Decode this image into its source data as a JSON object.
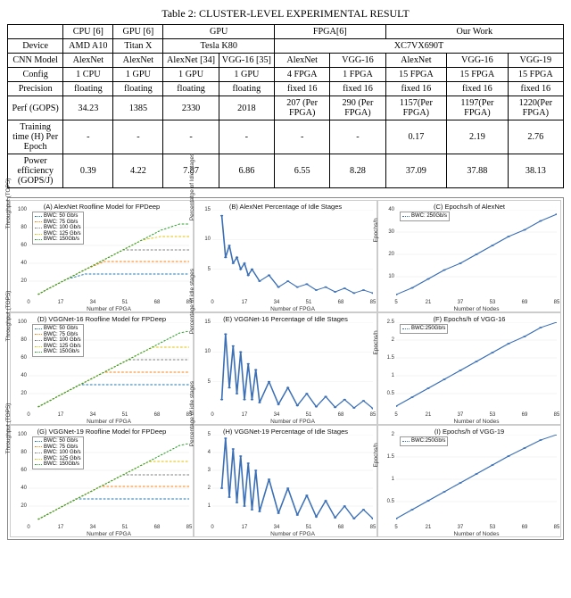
{
  "table": {
    "caption": "Table 2: CLUSTER-LEVEL EXPERIMENTAL RESULT",
    "col_headers_1": [
      "",
      "CPU [6]",
      "GPU [6]",
      "GPU",
      "GPU",
      "FPGA[6]",
      "FPGA[6]",
      "Our Work",
      "Our Work",
      "Our Work"
    ],
    "gpu_span_label": "GPU",
    "fpga_span_label": "FPGA[6]",
    "ourwork_span_label": "Our Work",
    "rows": [
      {
        "label": "Device",
        "cells": [
          "AMD A10",
          "Titan X",
          "Tesla K80",
          "Tesla K80",
          "XC7VX690T",
          "XC7VX690T",
          "XC7VX690T",
          "XC7VX690T",
          "XC7VX690T"
        ],
        "spans": {
          "tesla": "Tesla K80",
          "xc": "XC7VX690T"
        }
      },
      {
        "label": "CNN Model",
        "cells": [
          "AlexNet",
          "AlexNet",
          "AlexNet [34]",
          "VGG-16 [35]",
          "AlexNet",
          "VGG-16",
          "AlexNet",
          "VGG-16",
          "VGG-19"
        ]
      },
      {
        "label": "Config",
        "cells": [
          "1 CPU",
          "1 GPU",
          "1 GPU",
          "1 GPU",
          "4 FPGA",
          "1 FPGA",
          "15 FPGA",
          "15 FPGA",
          "15 FPGA"
        ]
      },
      {
        "label": "Precision",
        "cells": [
          "floating",
          "floating",
          "floating",
          "floating",
          "fixed 16",
          "fixed 16",
          "fixed 16",
          "fixed 16",
          "fixed 16"
        ]
      },
      {
        "label": "Perf (GOPS)",
        "cells": [
          "34.23",
          "1385",
          "2330",
          "2018",
          "207 (Per FPGA)",
          "290 (Per FPGA)",
          "1157(Per FPGA)",
          "1197(Per FPGA)",
          "1220(Per FPGA)"
        ]
      },
      {
        "label": "Training time (H) Per Epoch",
        "cells": [
          "-",
          "-",
          "-",
          "-",
          "-",
          "-",
          "0.17",
          "2.19",
          "2.76"
        ]
      },
      {
        "label": "Power efficiency (GOPS/J)",
        "cells": [
          "0.39",
          "4.22",
          "7.87",
          "6.86",
          "6.55",
          "8.28",
          "37.09",
          "37.88",
          "38.13"
        ]
      }
    ]
  },
  "chart_data": [
    {
      "id": "A",
      "type": "line",
      "title": "(A) AlexNet Roofline Model for FPDeep",
      "xlabel": "Number of FPGA",
      "ylabel": "Throughput (TOPS)",
      "xlim": [
        0,
        85
      ],
      "ylim": [
        0,
        100
      ],
      "yticks": [
        20,
        40,
        60,
        80,
        100
      ],
      "legend_pos": "tl",
      "series": [
        {
          "name": "BWC: 50 Gb/s",
          "color": "#1f77b4",
          "x": [
            5,
            10,
            20,
            30,
            40,
            50,
            60,
            70,
            80,
            85
          ],
          "y": [
            5,
            11,
            22,
            28,
            28,
            28,
            28,
            28,
            28,
            28
          ]
        },
        {
          "name": "BWC: 75 Gb/s",
          "color": "#ff7f0e",
          "x": [
            5,
            10,
            20,
            30,
            40,
            50,
            60,
            70,
            80,
            85
          ],
          "y": [
            5,
            11,
            22,
            33,
            42,
            42,
            42,
            42,
            42,
            42
          ]
        },
        {
          "name": "BWC: 100 Gb/s",
          "color": "#7f7f7f",
          "x": [
            5,
            10,
            20,
            30,
            40,
            50,
            60,
            70,
            80,
            85
          ],
          "y": [
            5,
            11,
            22,
            33,
            44,
            55,
            55,
            55,
            55,
            55
          ]
        },
        {
          "name": "BWC: 125 Gb/s",
          "color": "#e6c200",
          "x": [
            5,
            10,
            20,
            30,
            40,
            50,
            60,
            70,
            80,
            85
          ],
          "y": [
            5,
            11,
            22,
            33,
            44,
            55,
            66,
            70,
            70,
            70
          ]
        },
        {
          "name": "BWC: 150Gb/s",
          "color": "#2ca02c",
          "x": [
            5,
            10,
            20,
            30,
            40,
            50,
            60,
            70,
            80,
            85
          ],
          "y": [
            5,
            11,
            22,
            33,
            44,
            55,
            66,
            77,
            84,
            84
          ]
        }
      ]
    },
    {
      "id": "B",
      "type": "line",
      "title": "(B) AlexNet Percentage of Idle Stages",
      "xlabel": "Number of FPGA",
      "ylabel": "Percentatge of Idle stages",
      "xlim": [
        0,
        85
      ],
      "ylim": [
        0,
        15
      ],
      "yticks": [
        5,
        10,
        15
      ],
      "legend_pos": "none",
      "series": [
        {
          "name": "",
          "color": "#3b6fb6",
          "x": [
            5,
            7,
            9,
            11,
            13,
            15,
            17,
            19,
            21,
            25,
            30,
            35,
            40,
            45,
            50,
            55,
            60,
            65,
            70,
            75,
            80,
            85
          ],
          "y": [
            14,
            7,
            9,
            6,
            7,
            5,
            6,
            4,
            5,
            3,
            4,
            2,
            3,
            2,
            2.5,
            1.5,
            2,
            1.2,
            1.8,
            1,
            1.5,
            1
          ]
        }
      ]
    },
    {
      "id": "C",
      "type": "line",
      "title": "(C) Epochs/h of AlexNet",
      "xlabel": "Number of Nodes",
      "ylabel": "Epochs/h",
      "xlim": [
        5,
        85
      ],
      "ylim": [
        0,
        40
      ],
      "yticks": [
        10,
        20,
        30,
        40
      ],
      "legend_pos": "tl",
      "legend_override": [
        "BWC: 250Gb/s"
      ],
      "series": [
        {
          "name": "BWC: 250Gb/s",
          "color": "#3b6fb6",
          "x": [
            5,
            13,
            21,
            29,
            37,
            45,
            53,
            61,
            69,
            77,
            85
          ],
          "y": [
            2,
            5,
            9,
            13,
            16,
            20,
            24,
            28,
            31,
            35,
            38
          ]
        }
      ]
    },
    {
      "id": "D",
      "type": "line",
      "title": "(D) VGGNet-16 Roofline Model for FPDeep",
      "xlabel": "Number of FPGA",
      "ylabel": "Throughput (TOPS)",
      "xlim": [
        0,
        85
      ],
      "ylim": [
        0,
        100
      ],
      "yticks": [
        20,
        40,
        60,
        80,
        100
      ],
      "legend_pos": "tl",
      "series": [
        {
          "name": "BWC: 50 Gb/s",
          "color": "#1f77b4",
          "x": [
            5,
            20,
            27,
            40,
            60,
            80,
            85
          ],
          "y": [
            5,
            22,
            30,
            30,
            30,
            30,
            30
          ]
        },
        {
          "name": "BWC: 75 Gb/s",
          "color": "#ff7f0e",
          "x": [
            5,
            20,
            40,
            45,
            60,
            80,
            85
          ],
          "y": [
            5,
            22,
            44,
            44,
            44,
            44,
            44
          ]
        },
        {
          "name": "BWC: 100 Gb/s",
          "color": "#7f7f7f",
          "x": [
            5,
            20,
            40,
            53,
            60,
            80,
            85
          ],
          "y": [
            5,
            22,
            44,
            58,
            58,
            58,
            58
          ]
        },
        {
          "name": "BWC: 125 Gb/s",
          "color": "#e6c200",
          "x": [
            5,
            20,
            40,
            60,
            66,
            80,
            85
          ],
          "y": [
            5,
            22,
            44,
            66,
            72,
            72,
            72
          ]
        },
        {
          "name": "BWC: 150Gb/s",
          "color": "#2ca02c",
          "x": [
            5,
            20,
            40,
            60,
            80,
            85
          ],
          "y": [
            5,
            22,
            44,
            66,
            88,
            90
          ]
        }
      ]
    },
    {
      "id": "E",
      "type": "line",
      "title": "(E) VGGNet-16 Percentage of Idle Stages",
      "xlabel": "Number of FPGA",
      "ylabel": "Percentage of idle stages",
      "xlim": [
        0,
        85
      ],
      "ylim": [
        0,
        15
      ],
      "yticks": [
        5,
        10,
        15
      ],
      "legend_pos": "none",
      "series": [
        {
          "name": "",
          "color": "#3b6fb6",
          "x": [
            5,
            7,
            9,
            11,
            13,
            15,
            17,
            19,
            21,
            23,
            25,
            30,
            35,
            40,
            45,
            50,
            55,
            60,
            65,
            70,
            75,
            80,
            85
          ],
          "y": [
            2,
            13,
            4,
            11,
            3,
            10,
            2,
            8,
            2,
            7,
            1.5,
            5,
            1.2,
            4,
            1,
            3,
            0.8,
            2.5,
            0.7,
            2,
            0.6,
            1.8,
            0.5
          ]
        }
      ],
      "markers": true
    },
    {
      "id": "F",
      "type": "line",
      "title": "(F) Epochs/h of VGG-16",
      "xlabel": "Number of Nodes",
      "ylabel": "Epochs/h",
      "xlim": [
        5,
        85
      ],
      "ylim": [
        0,
        2.5
      ],
      "yticks": [
        0.5,
        1,
        1.5,
        2,
        2.5
      ],
      "legend_pos": "tl",
      "legend_override": [
        "BWC:250Gb/s"
      ],
      "series": [
        {
          "name": "BWC:250Gb/s",
          "color": "#3b6fb6",
          "x": [
            5,
            13,
            21,
            29,
            37,
            45,
            53,
            61,
            69,
            77,
            85
          ],
          "y": [
            0.15,
            0.4,
            0.65,
            0.9,
            1.15,
            1.4,
            1.65,
            1.9,
            2.1,
            2.35,
            2.5
          ]
        }
      ]
    },
    {
      "id": "G",
      "type": "line",
      "title": "(G) VGGNet-19 Roofline Model for FPDeep",
      "xlabel": "Number of FPGA",
      "ylabel": "Throughput (TOPS)",
      "xlim": [
        0,
        85
      ],
      "ylim": [
        0,
        100
      ],
      "yticks": [
        20,
        40,
        60,
        80,
        100
      ],
      "legend_pos": "tl",
      "series": [
        {
          "name": "BWC: 50 Gb/s",
          "color": "#1f77b4",
          "x": [
            5,
            20,
            25,
            40,
            60,
            80,
            85
          ],
          "y": [
            5,
            22,
            28,
            28,
            28,
            28,
            28
          ]
        },
        {
          "name": "BWC: 75 Gb/s",
          "color": "#ff7f0e",
          "x": [
            5,
            20,
            38,
            50,
            60,
            80,
            85
          ],
          "y": [
            5,
            22,
            42,
            42,
            42,
            42,
            42
          ]
        },
        {
          "name": "BWC: 100 Gb/s",
          "color": "#7f7f7f",
          "x": [
            5,
            20,
            40,
            50,
            60,
            80,
            85
          ],
          "y": [
            5,
            22,
            44,
            55,
            55,
            55,
            55
          ]
        },
        {
          "name": "BWC: 125 Gb/s",
          "color": "#e6c200",
          "x": [
            5,
            20,
            40,
            60,
            64,
            80,
            85
          ],
          "y": [
            5,
            22,
            44,
            66,
            70,
            70,
            70
          ]
        },
        {
          "name": "BWC: 150Gb/s",
          "color": "#2ca02c",
          "x": [
            5,
            20,
            40,
            60,
            80,
            85
          ],
          "y": [
            5,
            22,
            44,
            66,
            88,
            90
          ]
        }
      ]
    },
    {
      "id": "H",
      "type": "line",
      "title": "(H) VGGNet-19 Percentage of Idle Stages",
      "xlabel": "Number of FPGA",
      "ylabel": "Percentage of idle stages",
      "xlim": [
        0,
        85
      ],
      "ylim": [
        0,
        5
      ],
      "yticks": [
        1,
        2,
        3,
        4,
        5
      ],
      "legend_pos": "none",
      "series": [
        {
          "name": "",
          "color": "#3b6fb6",
          "x": [
            5,
            7,
            9,
            11,
            13,
            15,
            17,
            19,
            21,
            23,
            25,
            30,
            35,
            40,
            45,
            50,
            55,
            60,
            65,
            70,
            75,
            80,
            85
          ],
          "y": [
            2,
            4.8,
            1.5,
            4.2,
            1.2,
            3.8,
            1,
            3.4,
            0.8,
            3,
            0.7,
            2.5,
            0.6,
            2,
            0.5,
            1.6,
            0.4,
            1.3,
            0.35,
            1,
            0.3,
            0.8,
            0.3
          ]
        }
      ],
      "markers": true
    },
    {
      "id": "I",
      "type": "line",
      "title": "(I) Epochs/h of VGG-19",
      "xlabel": "Number of Nodes",
      "ylabel": "Epochs/h",
      "xlim": [
        5,
        85
      ],
      "ylim": [
        0,
        2
      ],
      "yticks": [
        0.5,
        1,
        1.5,
        2
      ],
      "legend_pos": "tl",
      "legend_override": [
        "BWC:250Gb/s"
      ],
      "series": [
        {
          "name": "BWC:250Gb/s",
          "color": "#3b6fb6",
          "x": [
            5,
            13,
            21,
            29,
            37,
            45,
            53,
            61,
            69,
            77,
            85
          ],
          "y": [
            0.12,
            0.32,
            0.52,
            0.72,
            0.92,
            1.12,
            1.32,
            1.52,
            1.7,
            1.88,
            2.0
          ]
        }
      ]
    }
  ]
}
